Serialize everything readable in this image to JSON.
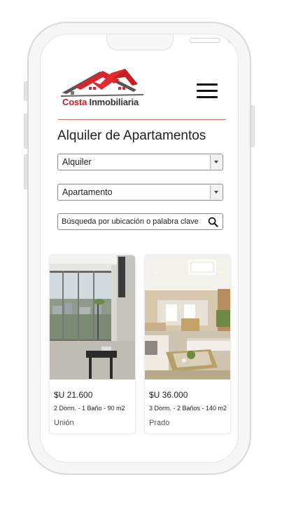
{
  "brand": {
    "name_part1": "Costa ",
    "name_part2": "Inmobiliaria",
    "accent": "#c62026"
  },
  "page": {
    "title": "Alquiler de Apartamentos"
  },
  "filters": {
    "operation": {
      "selected": "Alquiler"
    },
    "property_type": {
      "selected": "Apartamento"
    },
    "search": {
      "placeholder": "Búsqueda por ubicación o palabra clave"
    }
  },
  "listings": [
    {
      "price": "$U 21.600",
      "specs": "2 Dorm. - 1 Baño - 90 m2",
      "location": "Unión"
    },
    {
      "price": "$U 36.000",
      "specs": "3 Dorm. - 2 Baños - 140 m2",
      "location": "Prado"
    }
  ]
}
